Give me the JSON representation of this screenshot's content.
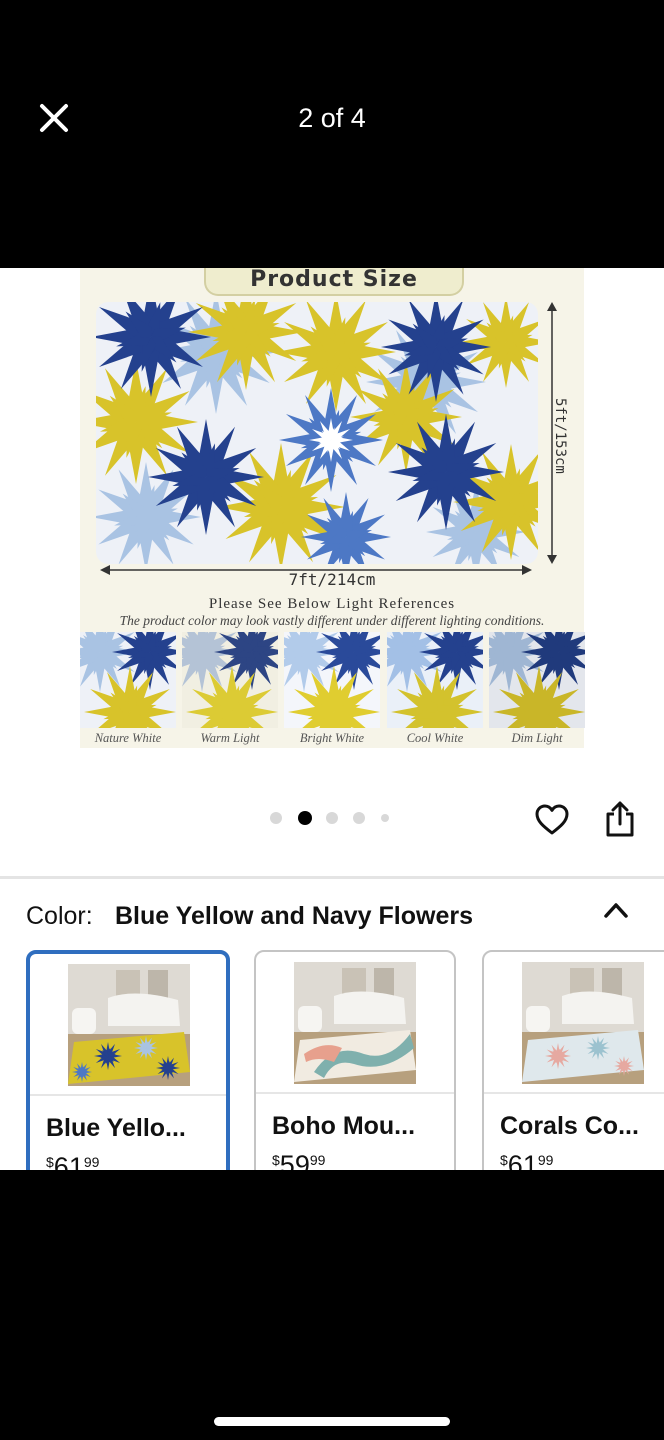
{
  "viewer": {
    "counter": "2 of 4",
    "close_icon": "close-icon"
  },
  "product_image": {
    "size_title": "Product Size",
    "height_dim": "5ft/153cm",
    "width_dim": "7ft/214cm",
    "light_title": "Please See Below Light References",
    "light_subtitle": "The product color may look vastly different under different lighting conditions.",
    "lights": [
      "Nature White",
      "Warm Light",
      "Bright White",
      "Cool White",
      "Dim Light"
    ],
    "colors": {
      "navy": "#24418e",
      "yellow": "#d8c32a",
      "light_blue": "#a9c3e3",
      "blue": "#4d78c5"
    }
  },
  "carousel": {
    "page_count": 5,
    "active_index": 1
  },
  "actions": {
    "favorite_icon": "heart-icon",
    "share_icon": "share-icon"
  },
  "color_selector": {
    "label": "Color:",
    "value": "Blue Yellow and Navy Flowers",
    "toggle_icon": "chevron-up-icon",
    "accent": "#2f6ebf",
    "options": [
      {
        "title": "Blue Yello...",
        "currency": "$",
        "price_whole": "61",
        "price_cents": "99",
        "selected": true
      },
      {
        "title": "Boho Mou...",
        "currency": "$",
        "price_whole": "59",
        "price_cents": "99",
        "selected": false
      },
      {
        "title": "Corals Co...",
        "currency": "$",
        "price_whole": "61",
        "price_cents": "99",
        "selected": false
      }
    ]
  }
}
